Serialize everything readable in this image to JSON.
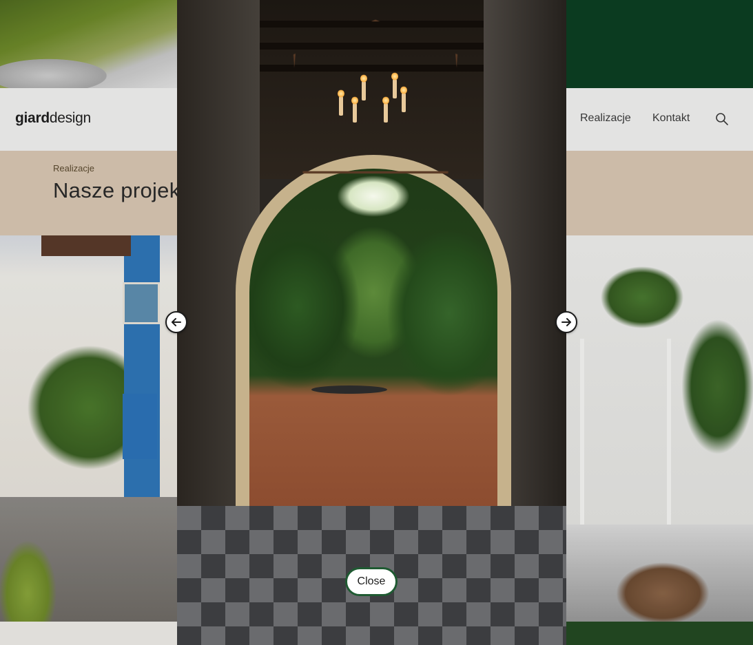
{
  "header": {
    "logo_bold": "giard",
    "logo_light": "design",
    "nav": {
      "realizacje": "Realizacje",
      "kontakt": "Kontakt"
    },
    "search_icon": "search-icon"
  },
  "hero": {
    "breadcrumb": "Realizacje",
    "title": "Nasze projekty"
  },
  "lightbox": {
    "prev_icon": "arrow-left-icon",
    "next_icon": "arrow-right-icon",
    "close_label": "Close"
  },
  "colors": {
    "brand_green": "#0c3f22",
    "hero_beige": "#d9c7b3",
    "close_border": "#1f5a32"
  }
}
